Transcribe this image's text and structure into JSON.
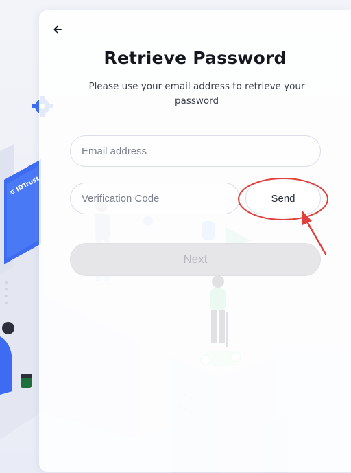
{
  "header": {
    "title": "Retrieve Password",
    "subtitle": "Please use your email address to retrieve your password"
  },
  "form": {
    "email_placeholder": "Email address",
    "code_placeholder": "Verification Code",
    "send_label": "Send",
    "next_label": "Next"
  },
  "illustration": {
    "card_brand": "≡ IDTrust"
  },
  "colors": {
    "accent_blue": "#3d6cf2",
    "annotation_red": "#e0403c",
    "disabled_button": "#e6e6e9"
  }
}
